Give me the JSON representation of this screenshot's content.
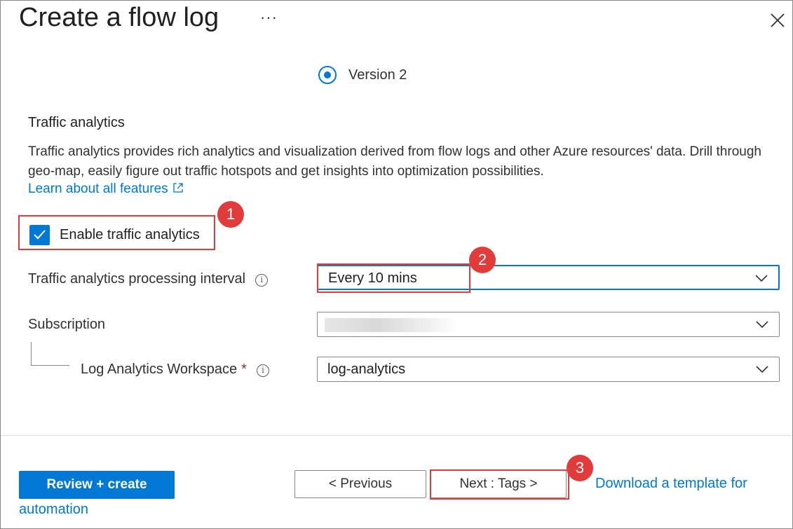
{
  "header": {
    "title": "Create a flow log",
    "more_label": "···"
  },
  "version": {
    "label": "Version 2",
    "selected": true
  },
  "traffic_analytics": {
    "title": "Traffic analytics",
    "description": "Traffic analytics provides rich analytics and visualization derived from flow logs and other Azure resources' data. Drill through geo-map, easily figure out traffic hotspots and get insights into optimization possibilities.",
    "learn_link": "Learn about all features",
    "enable_label": "Enable traffic analytics",
    "enable_checked": true
  },
  "fields": {
    "interval_label": "Traffic analytics processing interval",
    "interval_value": "Every 10 mins",
    "subscription_label": "Subscription",
    "subscription_value": "",
    "workspace_label": "Log Analytics Workspace",
    "workspace_required": "*",
    "workspace_value": "log-analytics"
  },
  "footer": {
    "review_label": "Review + create",
    "previous_label": "< Previous",
    "next_label": "Next : Tags >",
    "download_label": "Download a template for",
    "automation_label": "automation"
  },
  "callouts": [
    "1",
    "2",
    "3"
  ],
  "icons": {
    "close": "close-icon",
    "info": "info-icon",
    "external_link": "external-link-icon",
    "checkmark": "checkmark-icon",
    "chevron": "chevron-down-icon"
  },
  "colors": {
    "accent": "#0078d4",
    "callout": "#e03c3c",
    "required": "#a4262c"
  }
}
